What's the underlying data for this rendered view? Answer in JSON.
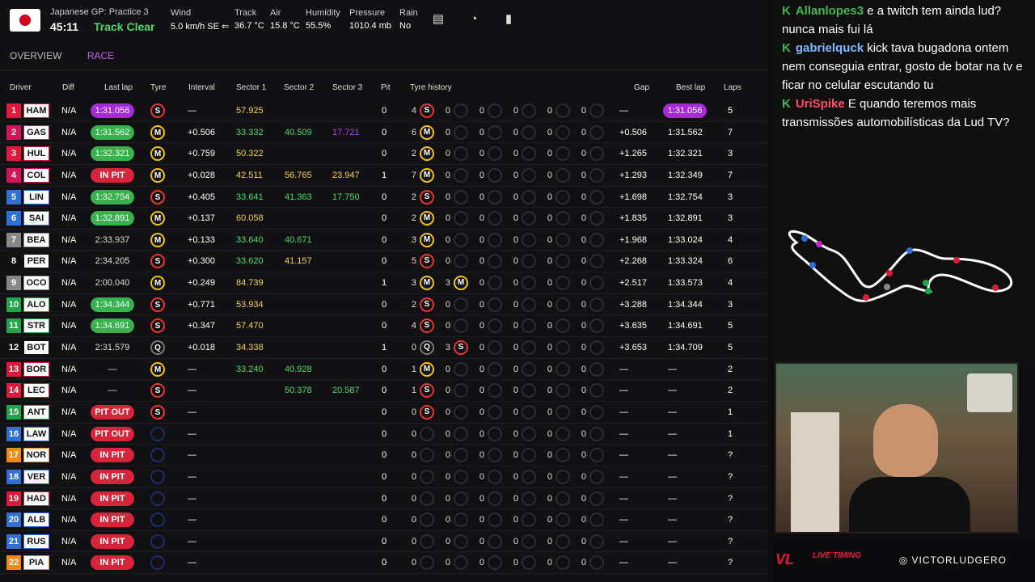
{
  "header": {
    "session": "Japanese GP: Practice 3",
    "clock": "45:11",
    "track_status": "Track Clear",
    "weather": [
      {
        "label": "Wind",
        "value": "5.0 km/h SE ⇐"
      },
      {
        "label": "Track",
        "value": "36.7 °C"
      },
      {
        "label": "Air",
        "value": "15.8 °C"
      },
      {
        "label": "Humidity",
        "value": "55.5%"
      },
      {
        "label": "Pressure",
        "value": "1010.4 mb"
      },
      {
        "label": "Rain",
        "value": "No"
      }
    ],
    "icons": [
      "document-icon",
      "speedometer-icon",
      "bar-chart-icon"
    ]
  },
  "tabs": [
    {
      "label": "OVERVIEW",
      "active": false
    },
    {
      "label": "RACE",
      "active": true
    }
  ],
  "columns": [
    "Driver",
    "Diff",
    "Last lap",
    "Tyre",
    "Interval",
    "Sector 1",
    "Sector 2",
    "Sector 3",
    "Pit",
    "Tyre history",
    "Gap",
    "Best lap",
    "Laps"
  ],
  "rows": [
    {
      "pos": "1",
      "color": "#e0183b",
      "code": "HAM",
      "diff": "N/A",
      "last": "1:31.056",
      "last_style": "purple",
      "tyre": "S",
      "interval": "—",
      "s1": "57.925",
      "s1c": "yellow",
      "s2": "",
      "s2c": "",
      "s3": "",
      "s3c": "",
      "pit": "0",
      "hist": [
        [
          "4",
          "S"
        ],
        [
          "0",
          ""
        ],
        [
          "0",
          ""
        ],
        [
          "0",
          ""
        ],
        [
          "0",
          ""
        ],
        [
          "0",
          ""
        ]
      ],
      "gap": "—",
      "best": "1:31.056",
      "best_style": "purple",
      "laps": "5"
    },
    {
      "pos": "2",
      "color": "#d4145a",
      "code": "GAS",
      "diff": "N/A",
      "last": "1:31.562",
      "last_style": "green",
      "tyre": "M",
      "interval": "+0.506",
      "s1": "33.332",
      "s1c": "green",
      "s2": "40.509",
      "s2c": "green",
      "s3": "17.721",
      "s3c": "purple",
      "pit": "0",
      "hist": [
        [
          "6",
          "M"
        ],
        [
          "0",
          ""
        ],
        [
          "0",
          ""
        ],
        [
          "0",
          ""
        ],
        [
          "0",
          ""
        ],
        [
          "0",
          ""
        ]
      ],
      "gap": "+0.506",
      "best": "1:31.562",
      "best_style": "plain",
      "laps": "7"
    },
    {
      "pos": "3",
      "color": "#e0183b",
      "code": "HUL",
      "diff": "N/A",
      "last": "1:32.321",
      "last_style": "green",
      "tyre": "M",
      "interval": "+0.759",
      "s1": "50.322",
      "s1c": "yellow",
      "s2": "",
      "s2c": "",
      "s3": "",
      "s3c": "",
      "pit": "0",
      "hist": [
        [
          "2",
          "M"
        ],
        [
          "0",
          ""
        ],
        [
          "0",
          ""
        ],
        [
          "0",
          ""
        ],
        [
          "0",
          ""
        ],
        [
          "0",
          ""
        ]
      ],
      "gap": "+1.265",
      "best": "1:32.321",
      "best_style": "plain",
      "laps": "3"
    },
    {
      "pos": "4",
      "color": "#d4145a",
      "code": "COL",
      "diff": "N/A",
      "last": "IN PIT",
      "last_style": "pit",
      "tyre": "M",
      "interval": "+0.028",
      "s1": "42.511",
      "s1c": "yellow",
      "s2": "56.765",
      "s2c": "yellow",
      "s3": "23.947",
      "s3c": "yellow",
      "pit": "1",
      "hist": [
        [
          "7",
          "M"
        ],
        [
          "0",
          ""
        ],
        [
          "0",
          ""
        ],
        [
          "0",
          ""
        ],
        [
          "0",
          ""
        ],
        [
          "0",
          ""
        ]
      ],
      "gap": "+1.293",
      "best": "1:32.349",
      "best_style": "plain",
      "laps": "7"
    },
    {
      "pos": "5",
      "color": "#2f6fd6",
      "code": "LIN",
      "diff": "N/A",
      "last": "1:32.754",
      "last_style": "green",
      "tyre": "S",
      "interval": "+0.405",
      "s1": "33.641",
      "s1c": "green",
      "s2": "41.363",
      "s2c": "green",
      "s3": "17.750",
      "s3c": "green",
      "pit": "0",
      "hist": [
        [
          "2",
          "S"
        ],
        [
          "0",
          ""
        ],
        [
          "0",
          ""
        ],
        [
          "0",
          ""
        ],
        [
          "0",
          ""
        ],
        [
          "0",
          ""
        ]
      ],
      "gap": "+1.698",
      "best": "1:32.754",
      "best_style": "plain",
      "laps": "3"
    },
    {
      "pos": "6",
      "color": "#2f6fd6",
      "code": "SAI",
      "diff": "N/A",
      "last": "1:32.891",
      "last_style": "green",
      "tyre": "M",
      "interval": "+0.137",
      "s1": "60.058",
      "s1c": "yellow",
      "s2": "",
      "s2c": "",
      "s3": "",
      "s3c": "",
      "pit": "0",
      "hist": [
        [
          "2",
          "M"
        ],
        [
          "0",
          ""
        ],
        [
          "0",
          ""
        ],
        [
          "0",
          ""
        ],
        [
          "0",
          ""
        ],
        [
          "0",
          ""
        ]
      ],
      "gap": "+1.835",
      "best": "1:32.891",
      "best_style": "plain",
      "laps": "3"
    },
    {
      "pos": "7",
      "color": "#888888",
      "code": "BEA",
      "diff": "N/A",
      "last": "2:33.937",
      "last_style": "plain",
      "tyre": "M",
      "interval": "+0.133",
      "s1": "33.640",
      "s1c": "green",
      "s2": "40.671",
      "s2c": "green",
      "s3": "",
      "s3c": "",
      "pit": "0",
      "hist": [
        [
          "3",
          "M"
        ],
        [
          "0",
          ""
        ],
        [
          "0",
          ""
        ],
        [
          "0",
          ""
        ],
        [
          "0",
          ""
        ],
        [
          "0",
          ""
        ]
      ],
      "gap": "+1.968",
      "best": "1:33.024",
      "best_style": "plain",
      "laps": "4"
    },
    {
      "pos": "8",
      "color": "#111111",
      "code": "PER",
      "diff": "N/A",
      "last": "2:34.205",
      "last_style": "plain",
      "tyre": "S",
      "interval": "+0.300",
      "s1": "33.620",
      "s1c": "green",
      "s2": "41.157",
      "s2c": "yellow",
      "s3": "",
      "s3c": "",
      "pit": "0",
      "hist": [
        [
          "5",
          "S"
        ],
        [
          "0",
          ""
        ],
        [
          "0",
          ""
        ],
        [
          "0",
          ""
        ],
        [
          "0",
          ""
        ],
        [
          "0",
          ""
        ]
      ],
      "gap": "+2.268",
      "best": "1:33.324",
      "best_style": "plain",
      "laps": "6"
    },
    {
      "pos": "9",
      "color": "#888888",
      "code": "OCO",
      "diff": "N/A",
      "last": "2:00.040",
      "last_style": "plain",
      "tyre": "M",
      "interval": "+0.249",
      "s1": "84.739",
      "s1c": "yellow",
      "s2": "",
      "s2c": "",
      "s3": "",
      "s3c": "",
      "pit": "1",
      "hist": [
        [
          "3",
          "M"
        ],
        [
          "3",
          "M"
        ],
        [
          "0",
          ""
        ],
        [
          "0",
          ""
        ],
        [
          "0",
          ""
        ],
        [
          "0",
          ""
        ]
      ],
      "gap": "+2.517",
      "best": "1:33.573",
      "best_style": "plain",
      "laps": "4"
    },
    {
      "pos": "10",
      "color": "#1fa64a",
      "code": "ALO",
      "diff": "N/A",
      "last": "1:34.344",
      "last_style": "green",
      "tyre": "S",
      "interval": "+0.771",
      "s1": "53.934",
      "s1c": "yellow",
      "s2": "",
      "s2c": "",
      "s3": "",
      "s3c": "",
      "pit": "0",
      "hist": [
        [
          "2",
          "S"
        ],
        [
          "0",
          ""
        ],
        [
          "0",
          ""
        ],
        [
          "0",
          ""
        ],
        [
          "0",
          ""
        ],
        [
          "0",
          ""
        ]
      ],
      "gap": "+3.288",
      "best": "1:34.344",
      "best_style": "plain",
      "laps": "3"
    },
    {
      "pos": "11",
      "color": "#1fa64a",
      "code": "STR",
      "diff": "N/A",
      "last": "1:34.691",
      "last_style": "green",
      "tyre": "S",
      "interval": "+0.347",
      "s1": "57.470",
      "s1c": "yellow",
      "s2": "",
      "s2c": "",
      "s3": "",
      "s3c": "",
      "pit": "0",
      "hist": [
        [
          "4",
          "S"
        ],
        [
          "0",
          ""
        ],
        [
          "0",
          ""
        ],
        [
          "0",
          ""
        ],
        [
          "0",
          ""
        ],
        [
          "0",
          ""
        ]
      ],
      "gap": "+3.635",
      "best": "1:34.691",
      "best_style": "plain",
      "laps": "5"
    },
    {
      "pos": "12",
      "color": "#111111",
      "code": "BOT",
      "diff": "N/A",
      "last": "2:31.579",
      "last_style": "plain",
      "tyre": "Q",
      "interval": "+0.018",
      "s1": "34.338",
      "s1c": "yellow",
      "s2": "",
      "s2c": "",
      "s3": "",
      "s3c": "",
      "pit": "1",
      "hist": [
        [
          "0",
          "Q"
        ],
        [
          "3",
          "S"
        ],
        [
          "0",
          ""
        ],
        [
          "0",
          ""
        ],
        [
          "0",
          ""
        ],
        [
          "0",
          ""
        ]
      ],
      "gap": "+3.653",
      "best": "1:34.709",
      "best_style": "plain",
      "laps": "5"
    },
    {
      "pos": "13",
      "color": "#e0183b",
      "code": "BOR",
      "diff": "N/A",
      "last": "—",
      "last_style": "plain",
      "tyre": "M",
      "interval": "—",
      "s1": "33.240",
      "s1c": "green",
      "s2": "40.928",
      "s2c": "green",
      "s3": "",
      "s3c": "",
      "pit": "0",
      "hist": [
        [
          "1",
          "M"
        ],
        [
          "0",
          ""
        ],
        [
          "0",
          ""
        ],
        [
          "0",
          ""
        ],
        [
          "0",
          ""
        ],
        [
          "0",
          ""
        ]
      ],
      "gap": "—",
      "best": "—",
      "best_style": "plain",
      "laps": "2"
    },
    {
      "pos": "14",
      "color": "#e0183b",
      "code": "LEC",
      "diff": "N/A",
      "last": "—",
      "last_style": "plain",
      "tyre": "S",
      "interval": "—",
      "s1": "",
      "s1c": "",
      "s2": "50.378",
      "s2c": "green",
      "s3": "20.587",
      "s3c": "green",
      "pit": "0",
      "hist": [
        [
          "1",
          "S"
        ],
        [
          "0",
          ""
        ],
        [
          "0",
          ""
        ],
        [
          "0",
          ""
        ],
        [
          "0",
          ""
        ],
        [
          "0",
          ""
        ]
      ],
      "gap": "—",
      "best": "—",
      "best_style": "plain",
      "laps": "2"
    },
    {
      "pos": "15",
      "color": "#1fa64a",
      "code": "ANT",
      "diff": "N/A",
      "last": "PIT OUT",
      "last_style": "pit",
      "tyre": "S",
      "interval": "—",
      "s1": "",
      "s1c": "",
      "s2": "",
      "s2c": "",
      "s3": "",
      "s3c": "",
      "pit": "0",
      "hist": [
        [
          "0",
          "S"
        ],
        [
          "0",
          ""
        ],
        [
          "0",
          ""
        ],
        [
          "0",
          ""
        ],
        [
          "0",
          ""
        ],
        [
          "0",
          ""
        ]
      ],
      "gap": "—",
      "best": "—",
      "best_style": "plain",
      "laps": "1"
    },
    {
      "pos": "16",
      "color": "#2f6fd6",
      "code": "LAW",
      "diff": "N/A",
      "last": "PIT OUT",
      "last_style": "pit",
      "tyre": "E",
      "interval": "—",
      "s1": "",
      "s1c": "",
      "s2": "",
      "s2c": "",
      "s3": "",
      "s3c": "",
      "pit": "0",
      "hist": [
        [
          "0",
          ""
        ],
        [
          "0",
          ""
        ],
        [
          "0",
          ""
        ],
        [
          "0",
          ""
        ],
        [
          "0",
          ""
        ],
        [
          "0",
          ""
        ]
      ],
      "gap": "—",
      "best": "—",
      "best_style": "plain",
      "laps": "1"
    },
    {
      "pos": "17",
      "color": "#f08a16",
      "code": "NOR",
      "diff": "N/A",
      "last": "IN PIT",
      "last_style": "pit",
      "tyre": "E",
      "interval": "—",
      "s1": "",
      "s1c": "",
      "s2": "",
      "s2c": "",
      "s3": "",
      "s3c": "",
      "pit": "0",
      "hist": [
        [
          "0",
          ""
        ],
        [
          "0",
          ""
        ],
        [
          "0",
          ""
        ],
        [
          "0",
          ""
        ],
        [
          "0",
          ""
        ],
        [
          "0",
          ""
        ]
      ],
      "gap": "—",
      "best": "—",
      "best_style": "plain",
      "laps": "?"
    },
    {
      "pos": "18",
      "color": "#2f6fd6",
      "code": "VER",
      "diff": "N/A",
      "last": "IN PIT",
      "last_style": "pit",
      "tyre": "E",
      "interval": "—",
      "s1": "",
      "s1c": "",
      "s2": "",
      "s2c": "",
      "s3": "",
      "s3c": "",
      "pit": "0",
      "hist": [
        [
          "0",
          ""
        ],
        [
          "0",
          ""
        ],
        [
          "0",
          ""
        ],
        [
          "0",
          ""
        ],
        [
          "0",
          ""
        ],
        [
          "0",
          ""
        ]
      ],
      "gap": "—",
      "best": "—",
      "best_style": "plain",
      "laps": "?"
    },
    {
      "pos": "19",
      "color": "#e0183b",
      "code": "HAD",
      "diff": "N/A",
      "last": "IN PIT",
      "last_style": "pit",
      "tyre": "E",
      "interval": "—",
      "s1": "",
      "s1c": "",
      "s2": "",
      "s2c": "",
      "s3": "",
      "s3c": "",
      "pit": "0",
      "hist": [
        [
          "0",
          ""
        ],
        [
          "0",
          ""
        ],
        [
          "0",
          ""
        ],
        [
          "0",
          ""
        ],
        [
          "0",
          ""
        ],
        [
          "0",
          ""
        ]
      ],
      "gap": "—",
      "best": "—",
      "best_style": "plain",
      "laps": "?"
    },
    {
      "pos": "20",
      "color": "#2f6fd6",
      "code": "ALB",
      "diff": "N/A",
      "last": "IN PIT",
      "last_style": "pit",
      "tyre": "E",
      "interval": "—",
      "s1": "",
      "s1c": "",
      "s2": "",
      "s2c": "",
      "s3": "",
      "s3c": "",
      "pit": "0",
      "hist": [
        [
          "0",
          ""
        ],
        [
          "0",
          ""
        ],
        [
          "0",
          ""
        ],
        [
          "0",
          ""
        ],
        [
          "0",
          ""
        ],
        [
          "0",
          ""
        ]
      ],
      "gap": "—",
      "best": "—",
      "best_style": "plain",
      "laps": "?"
    },
    {
      "pos": "21",
      "color": "#2f6fd6",
      "code": "RUS",
      "diff": "N/A",
      "last": "IN PIT",
      "last_style": "pit",
      "tyre": "E",
      "interval": "—",
      "s1": "",
      "s1c": "",
      "s2": "",
      "s2c": "",
      "s3": "",
      "s3c": "",
      "pit": "0",
      "hist": [
        [
          "0",
          ""
        ],
        [
          "0",
          ""
        ],
        [
          "0",
          ""
        ],
        [
          "0",
          ""
        ],
        [
          "0",
          ""
        ],
        [
          "0",
          ""
        ]
      ],
      "gap": "—",
      "best": "—",
      "best_style": "plain",
      "laps": "?"
    },
    {
      "pos": "22",
      "color": "#f08a16",
      "code": "PIA",
      "diff": "N/A",
      "last": "IN PIT",
      "last_style": "pit",
      "tyre": "E",
      "interval": "—",
      "s1": "",
      "s1c": "",
      "s2": "",
      "s2c": "",
      "s3": "",
      "s3c": "",
      "pit": "0",
      "hist": [
        [
          "0",
          ""
        ],
        [
          "0",
          ""
        ],
        [
          "0",
          ""
        ],
        [
          "0",
          ""
        ],
        [
          "0",
          ""
        ],
        [
          "0",
          ""
        ]
      ],
      "gap": "—",
      "best": "—",
      "best_style": "plain",
      "laps": "?"
    }
  ],
  "chat": [
    {
      "user": "Allanlopes3",
      "color": "#3fb950",
      "text": "e a twitch tem ainda lud? nunca mais fui lá"
    },
    {
      "user": "gabrielquck",
      "color": "#7ab8ff",
      "text": "kick tava bugadona ontem nem conseguia entrar, gosto de botar na tv e ficar no celular escutando tu"
    },
    {
      "user": "UriSpike",
      "color": "#ff4d6a",
      "text": "E quando teremos mais transmissões automobilísticas da Lud TV?"
    }
  ],
  "brand": {
    "logo": "VL",
    "logo_sub": "LIVE TIMING",
    "instagram": "VICTORLUDGERO"
  }
}
